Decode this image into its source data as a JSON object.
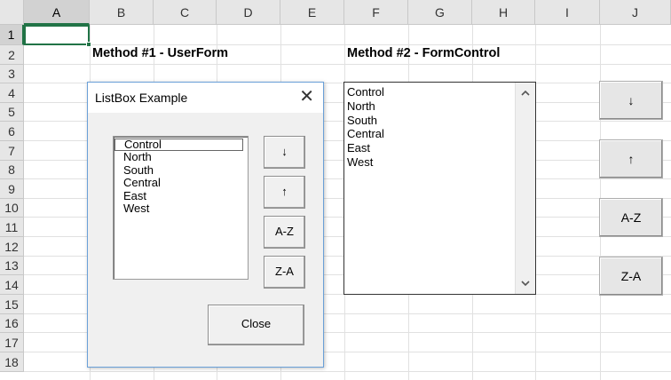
{
  "columns": [
    "A",
    "B",
    "C",
    "D",
    "E",
    "F",
    "G",
    "H",
    "I",
    "J"
  ],
  "rows": [
    "1",
    "2",
    "3",
    "4",
    "5",
    "6",
    "7",
    "8",
    "9",
    "10",
    "11",
    "12",
    "13",
    "14",
    "15",
    "16",
    "17",
    "18"
  ],
  "headings": {
    "method1": "Method #1 - UserForm",
    "method2": "Method #2 - FormControl"
  },
  "listbox_items": [
    "Control",
    "North",
    "South",
    "Central",
    "East",
    "West"
  ],
  "sheet_buttons": {
    "down": "↓",
    "up": "↑",
    "az": "A-Z",
    "za": "Z-A"
  },
  "sheet_scrollbar": {
    "up_icon": "chevron-up-icon",
    "down_icon": "chevron-down-icon"
  },
  "dialog": {
    "title": "ListBox Example",
    "close_glyph": "✕",
    "buttons": {
      "down": "↓",
      "up": "↑",
      "az": "A-Z",
      "za": "Z-A"
    },
    "close_button": "Close"
  },
  "colors": {
    "accent": "#217346",
    "header_bg": "#e6e6e6",
    "dialog_border": "#6aa0d8"
  }
}
